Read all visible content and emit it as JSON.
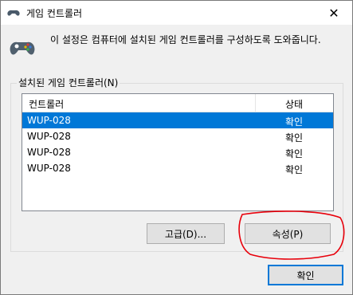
{
  "window": {
    "title": "게임 컨트롤러",
    "close_glyph": "✕",
    "description": "이 설정은 컴퓨터에 설치된 게임 컨트롤러를 구성하도록 도와줍니다."
  },
  "group": {
    "label": "설치된 게임 컨트롤러(N)"
  },
  "table": {
    "columns": [
      "컨트롤러",
      "상태"
    ],
    "rows": [
      {
        "name": "WUP-028",
        "status": "확인",
        "selected": true
      },
      {
        "name": "WUP-028",
        "status": "확인",
        "selected": false
      },
      {
        "name": "WUP-028",
        "status": "확인",
        "selected": false
      },
      {
        "name": "WUP-028",
        "status": "확인",
        "selected": false
      }
    ]
  },
  "buttons": {
    "advanced": "고급(D)...",
    "properties": "속성(P)",
    "ok": "확인"
  },
  "colors": {
    "selection": "#0078d7",
    "annotation": "#e8000b"
  }
}
